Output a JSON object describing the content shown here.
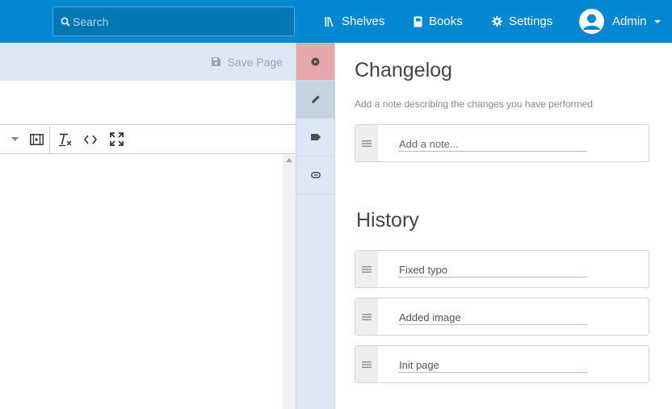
{
  "header": {
    "search_placeholder": "Search",
    "nav": {
      "shelves": "Shelves",
      "books": "Books",
      "settings": "Settings",
      "user": "Admin"
    },
    "color": "#0288d1"
  },
  "editor": {
    "save_label": "Save Page"
  },
  "rail": {
    "tabs": [
      "tag-icon",
      "edit-icon",
      "label-icon",
      "attachment-icon"
    ],
    "active_color": "#e8a7ad"
  },
  "panel": {
    "changelog_title": "Changelog",
    "changelog_desc": "Add a note describing the changes you have performed",
    "note_placeholder": "Add a note...",
    "history_title": "History",
    "history": [
      "Fixed typo",
      "Added image",
      "Init page"
    ]
  }
}
